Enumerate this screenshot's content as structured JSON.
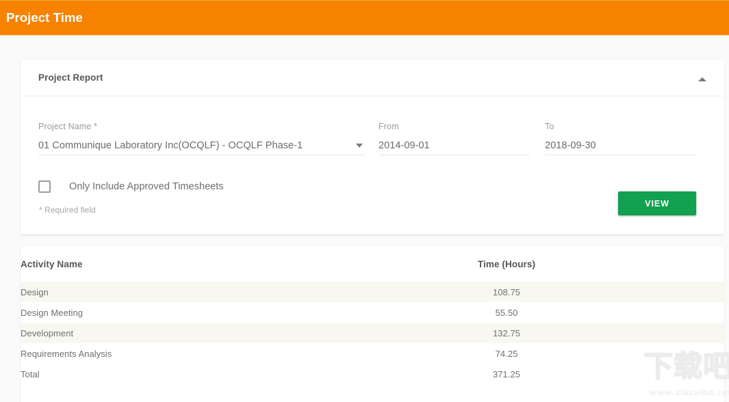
{
  "appbar": {
    "title": "Project Time",
    "background_color": "#f78200",
    "text_color": "#ffffff"
  },
  "report_panel": {
    "title": "Project Report",
    "collapse_icon": "caret-up-icon",
    "fields": {
      "project": {
        "label": "Project Name *",
        "label_text": "Project Name",
        "required_marker": "*",
        "value": "01 Communique Laboratory Inc(OCQLF) - OCQLF Phase-1",
        "dropdown_icon": "caret-down-icon"
      },
      "from": {
        "label": "From",
        "value": "2014-09-01"
      },
      "to": {
        "label": "To",
        "value": "2018-09-30"
      }
    },
    "checkbox": {
      "label": "Only Include Approved Timesheets",
      "checked": false
    },
    "required_note": "* Required field",
    "view_button": {
      "label": "VIEW",
      "color": "#12a150"
    }
  },
  "results_table": {
    "columns": [
      "Activity Name",
      "Time (Hours)"
    ],
    "rows": [
      {
        "activity": "Design",
        "hours": "108.75"
      },
      {
        "activity": "Design Meeting",
        "hours": "55.50"
      },
      {
        "activity": "Development",
        "hours": "132.75"
      },
      {
        "activity": "Requirements Analysis",
        "hours": "74.25"
      },
      {
        "activity": "Total",
        "hours": "371.25"
      }
    ],
    "alt_row_color": "#f8f8f1"
  },
  "watermark": {
    "cjk": "下载吧",
    "url": "www.xiazaiba.com"
  }
}
